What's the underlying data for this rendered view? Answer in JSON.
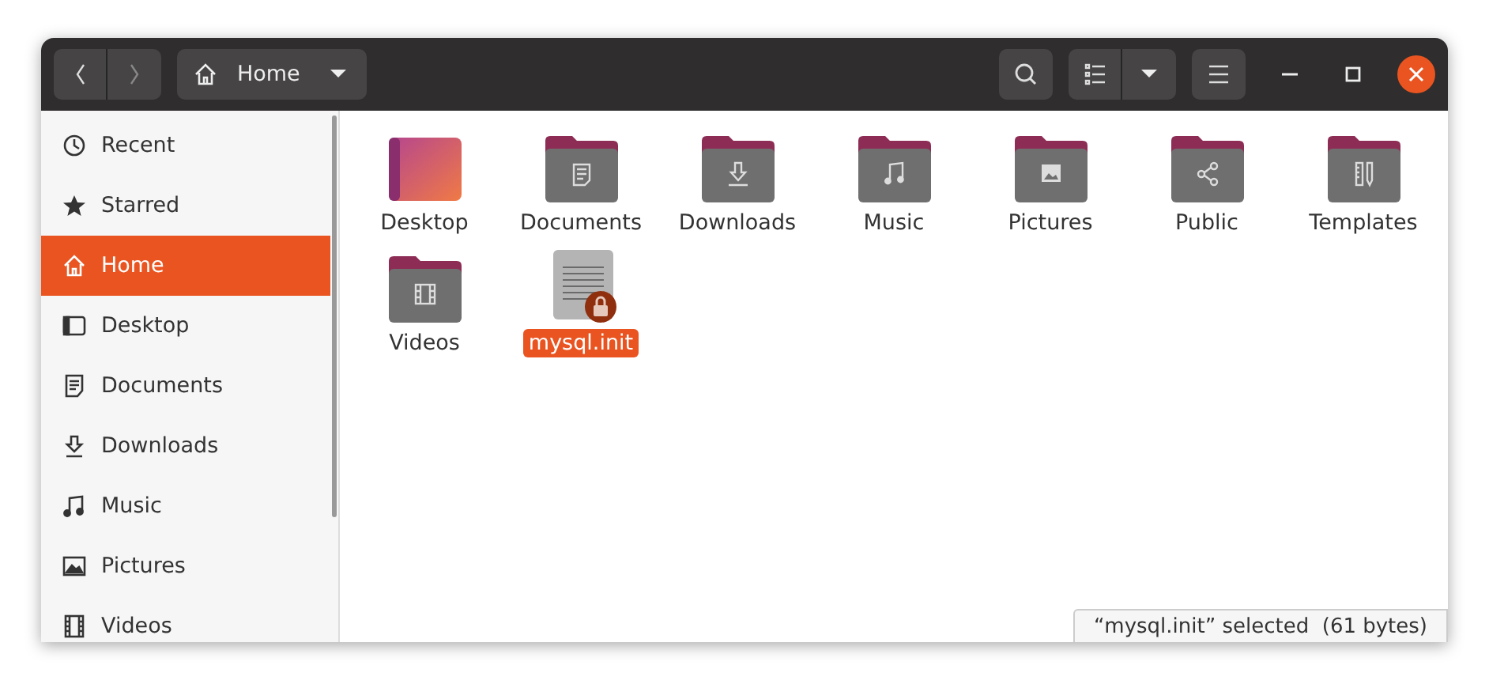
{
  "header": {
    "path_button": {
      "label": "Home"
    }
  },
  "sidebar": {
    "items": [
      {
        "label": "Recent",
        "selected": false
      },
      {
        "label": "Starred",
        "selected": false
      },
      {
        "label": "Home",
        "selected": true
      },
      {
        "label": "Desktop",
        "selected": false
      },
      {
        "label": "Documents",
        "selected": false
      },
      {
        "label": "Downloads",
        "selected": false
      },
      {
        "label": "Music",
        "selected": false
      },
      {
        "label": "Pictures",
        "selected": false
      },
      {
        "label": "Videos",
        "selected": false
      }
    ]
  },
  "files": [
    {
      "name": "Desktop",
      "kind": "desktop",
      "selected": false
    },
    {
      "name": "Documents",
      "kind": "folder",
      "selected": false
    },
    {
      "name": "Downloads",
      "kind": "folder",
      "selected": false
    },
    {
      "name": "Music",
      "kind": "folder",
      "selected": false
    },
    {
      "name": "Pictures",
      "kind": "folder",
      "selected": false
    },
    {
      "name": "Public",
      "kind": "folder",
      "selected": false
    },
    {
      "name": "Templates",
      "kind": "folder",
      "selected": false
    },
    {
      "name": "Videos",
      "kind": "folder",
      "selected": false
    },
    {
      "name": "mysql.init",
      "kind": "locked-file",
      "selected": true
    }
  ],
  "status_bar": {
    "text": "“mysql.init” selected  (61 bytes)"
  }
}
